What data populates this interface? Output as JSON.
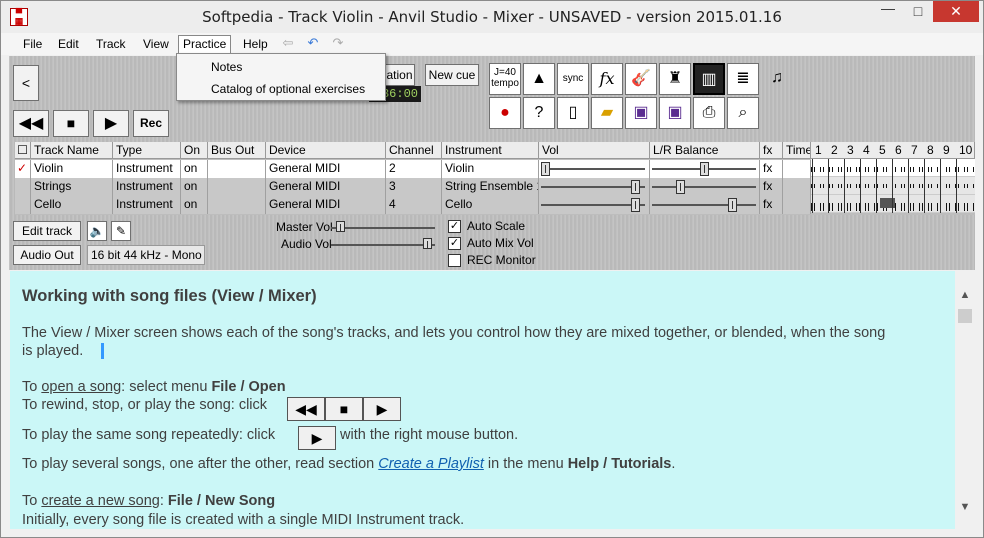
{
  "window": {
    "title": "Softpedia - Track Violin - Anvil Studio - Mixer - UNSAVED - version 2015.01.16",
    "minimize": "—",
    "maximize": "□",
    "close": "✕"
  },
  "menu": {
    "items": [
      "File",
      "Edit",
      "Track",
      "View",
      "Practice",
      "Help"
    ]
  },
  "practice_menu": {
    "items": [
      "Notes",
      "Catalog of optional exercises"
    ]
  },
  "toolbar": {
    "prev": "<",
    "btn_partial": "ation",
    "new_cue": "New cue",
    "lcd_time": "36:00",
    "tempo_label": "tempo",
    "tempo_value": "J=40",
    "rec": "Rec",
    "sync": "sync",
    "fx": "fx",
    "help": "?"
  },
  "table": {
    "headers": [
      "",
      "Track Name",
      "Type",
      "On",
      "Bus Out",
      "Device",
      "Channel",
      "Instrument",
      "Vol",
      "L/R Balance",
      "fx",
      "Time"
    ],
    "measures": [
      "1",
      "2",
      "3",
      "4",
      "5",
      "6",
      "7",
      "8",
      "9",
      "10"
    ],
    "rows": [
      {
        "mark": "✓",
        "name": "Violin",
        "type": "Instrument",
        "on": "on",
        "bus": "",
        "device": "General MIDI",
        "channel": "2",
        "instrument": "Violin",
        "vol": 0.0,
        "bal": 0.5,
        "fx": "fx"
      },
      {
        "mark": "",
        "name": "Strings",
        "type": "Instrument",
        "on": "on",
        "bus": "",
        "device": "General MIDI",
        "channel": "3",
        "instrument": "String Ensemble 1",
        "vol": 0.95,
        "bal": 0.25,
        "fx": "fx"
      },
      {
        "mark": "",
        "name": "Cello",
        "type": "Instrument",
        "on": "on",
        "bus": "",
        "device": "General MIDI",
        "channel": "4",
        "instrument": "Cello",
        "vol": 0.95,
        "bal": 0.8,
        "fx": "fx"
      }
    ]
  },
  "mixer": {
    "edit_track": "Edit track",
    "audio_out": "Audio Out",
    "audio_format": "16 bit 44 kHz - Mono",
    "master_vol": "Master Vol",
    "audio_vol": "Audio Vol",
    "auto_scale": "Auto Scale",
    "auto_mix_vol": "Auto Mix Vol",
    "rec_monitor": "REC Monitor",
    "auto_scale_checked": "✓",
    "auto_mix_checked": "✓",
    "master_level": 0.05,
    "audio_level": 0.95
  },
  "help": {
    "heading": "Working with song files (View / Mixer)",
    "p1a": "The View / Mixer screen shows each of the song's tracks, and lets you control how they are mixed together, or blended, when the song",
    "p1b": "is played.",
    "open_pre": "To ",
    "open_link": "open a song",
    "open_mid": ": select menu ",
    "open_bold": "File / Open",
    "rewind": "To rewind, stop, or play the song: click",
    "repeat_pre": "To play the same song repeatedly: click",
    "repeat_post": "with the right mouse button.",
    "playlist_pre": "To play several songs, one after the other, read section ",
    "playlist_link": "Create a Playlist",
    "playlist_mid": " in the menu ",
    "playlist_bold": "Help / Tutorials",
    "playlist_end": ".",
    "new_pre": "To ",
    "new_link": "create a new song",
    "new_mid": ": ",
    "new_bold": "File / New Song",
    "last": "Initially, every song file is created with a single MIDI Instrument track."
  }
}
